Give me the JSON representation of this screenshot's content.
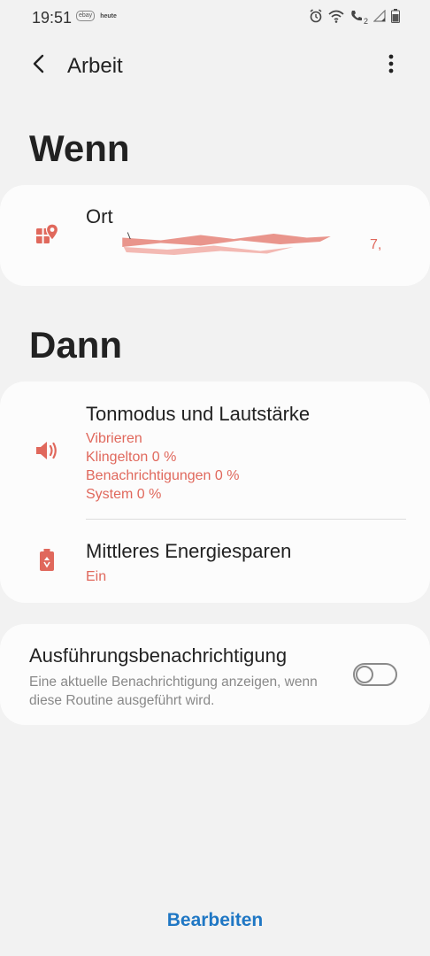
{
  "status_bar": {
    "time": "19:51",
    "notif_badge": "ebay",
    "notif_text": "heute",
    "sim_indicator": "2"
  },
  "app_bar": {
    "title": "Arbeit",
    "back_icon": "chevron-left-icon",
    "more_icon": "more-vertical-icon"
  },
  "if_section": {
    "heading": "Wenn",
    "location": {
      "title": "Ort",
      "address_tail": "7,",
      "icon": "map-location-icon"
    }
  },
  "then_section": {
    "heading": "Dann",
    "sound": {
      "title": "Tonmodus und Lautstärke",
      "lines": [
        "Vibrieren",
        "Klingelton 0 %",
        "Benachrichtigungen 0 %",
        "System 0 %"
      ],
      "icon": "speaker-icon"
    },
    "power": {
      "title": "Mittleres Energiesparen",
      "value": "Ein",
      "icon": "battery-saver-icon"
    }
  },
  "notification": {
    "title": "Ausführungsbenachrichtigung",
    "description": "Eine aktuelle Benachrichtigung anzeigen, wenn diese Routine ausgeführt wird.",
    "toggle_on": false
  },
  "footer": {
    "edit_label": "Bearbeiten"
  },
  "colors": {
    "accent": "#e0685c",
    "link": "#1f77c4",
    "background": "#f2f2f2",
    "card": "#fcfcfc"
  }
}
